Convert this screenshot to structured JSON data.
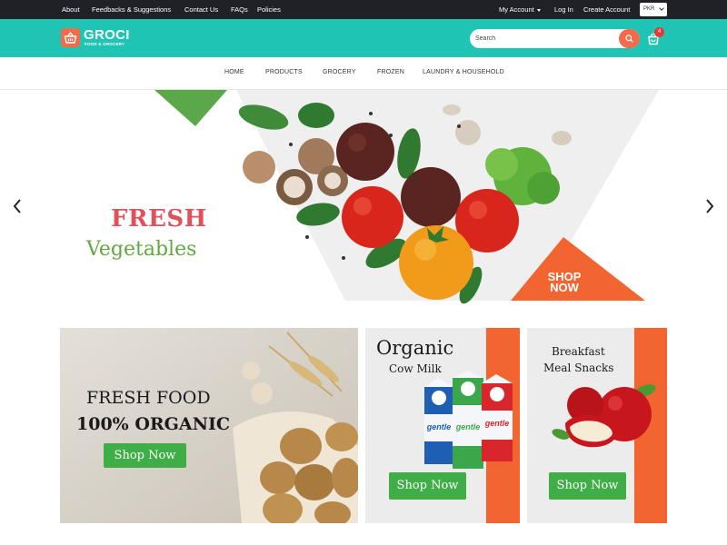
{
  "topbar": {
    "links": [
      "About",
      "Feedbacks & Suggestions",
      "Contact Us",
      "FAQs",
      "Policies"
    ],
    "my_account": "My Account",
    "login": "Log In",
    "create_account": "Create Account",
    "currency": "PKR"
  },
  "header": {
    "logo_title": "GROCI",
    "logo_subtitle": "FOOD & GROCERY",
    "search_placeholder": "Search",
    "cart_count": "4"
  },
  "nav": {
    "items": [
      "HOME",
      "PRODUCTS",
      "GROCERY",
      "FROZEN",
      "LAUNDRY & HOUSEHOLD"
    ]
  },
  "hero": {
    "headline": "FRESH",
    "subheadline": "Vegetables",
    "cta_line1": "SHOP",
    "cta_line2": "NOW"
  },
  "banners": [
    {
      "line1": "FRESH FOOD",
      "line2": "100% ORGANIC",
      "button": "Shop Now"
    },
    {
      "title": "Organic",
      "subtitle": "Cow Milk",
      "button": "Shop Now",
      "carton_brand": "gentle"
    },
    {
      "title": "Breakfast",
      "subtitle": "Meal Snacks",
      "button": "Shop Now"
    }
  ],
  "colors": {
    "teal": "#20c4b4",
    "orange": "#f26b4a",
    "dark": "#1f2126",
    "green": "#3fae46",
    "red_text": "#e2505a",
    "green_text": "#5faa3e"
  },
  "icons": [
    "basket-icon",
    "search-icon",
    "cart-icon",
    "caret-down-icon",
    "chevron-left-icon",
    "chevron-right-icon"
  ]
}
